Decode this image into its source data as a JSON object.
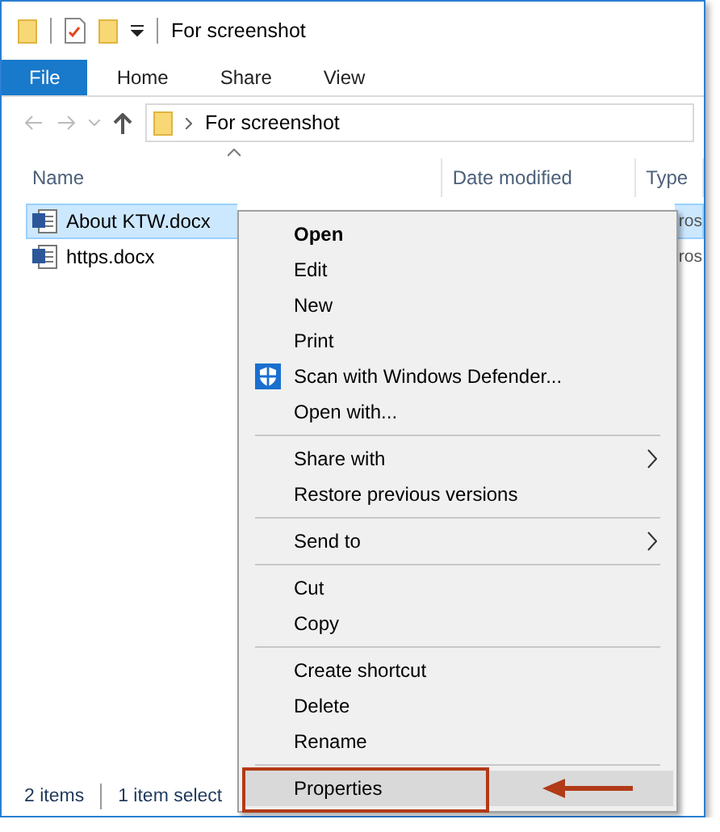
{
  "title_bar": {
    "title": "For screenshot"
  },
  "ribbon_tabs": [
    {
      "label": "File",
      "selected": true
    },
    {
      "label": "Home",
      "selected": false
    },
    {
      "label": "Share",
      "selected": false
    },
    {
      "label": "View",
      "selected": false
    }
  ],
  "address_bar": {
    "path": "For screenshot"
  },
  "columns": [
    "Name",
    "Date modified",
    "Type"
  ],
  "files": [
    {
      "name": "About KTW.docx",
      "type": "ros",
      "selected": true
    },
    {
      "name": "https.docx",
      "type": "ros",
      "selected": false
    }
  ],
  "status_bar": [
    "2 items",
    "1 item select"
  ],
  "context_menu": {
    "items": [
      {
        "kind": "item",
        "label": "Open",
        "default": true,
        "submenu": false,
        "highlighted": false
      },
      {
        "kind": "item",
        "label": "Edit",
        "default": false,
        "submenu": false,
        "highlighted": false
      },
      {
        "kind": "item",
        "label": "New",
        "default": false,
        "submenu": false,
        "highlighted": false
      },
      {
        "kind": "item",
        "label": "Print",
        "default": false,
        "submenu": false,
        "highlighted": false
      },
      {
        "kind": "icon-item",
        "label": "Scan with Windows Defender...",
        "default": false,
        "submenu": false,
        "highlighted": false
      },
      {
        "kind": "item",
        "label": "Open with...",
        "default": false,
        "submenu": false,
        "highlighted": false
      },
      {
        "kind": "separator"
      },
      {
        "kind": "item",
        "label": "Share with",
        "default": false,
        "submenu": true,
        "highlighted": false
      },
      {
        "kind": "item",
        "label": "Restore previous versions",
        "default": false,
        "submenu": false,
        "highlighted": false
      },
      {
        "kind": "separator"
      },
      {
        "kind": "item",
        "label": "Send to",
        "default": false,
        "submenu": true,
        "highlighted": false
      },
      {
        "kind": "separator"
      },
      {
        "kind": "item",
        "label": "Cut",
        "default": false,
        "submenu": false,
        "highlighted": false
      },
      {
        "kind": "item",
        "label": "Copy",
        "default": false,
        "submenu": false,
        "highlighted": false
      },
      {
        "kind": "separator"
      },
      {
        "kind": "item",
        "label": "Create shortcut",
        "default": false,
        "submenu": false,
        "highlighted": false
      },
      {
        "kind": "item",
        "label": "Delete",
        "default": false,
        "submenu": false,
        "highlighted": false
      },
      {
        "kind": "item",
        "label": "Rename",
        "default": false,
        "submenu": false,
        "highlighted": false
      },
      {
        "kind": "separator"
      },
      {
        "kind": "item",
        "label": "Properties",
        "default": false,
        "submenu": false,
        "highlighted": true
      }
    ]
  }
}
